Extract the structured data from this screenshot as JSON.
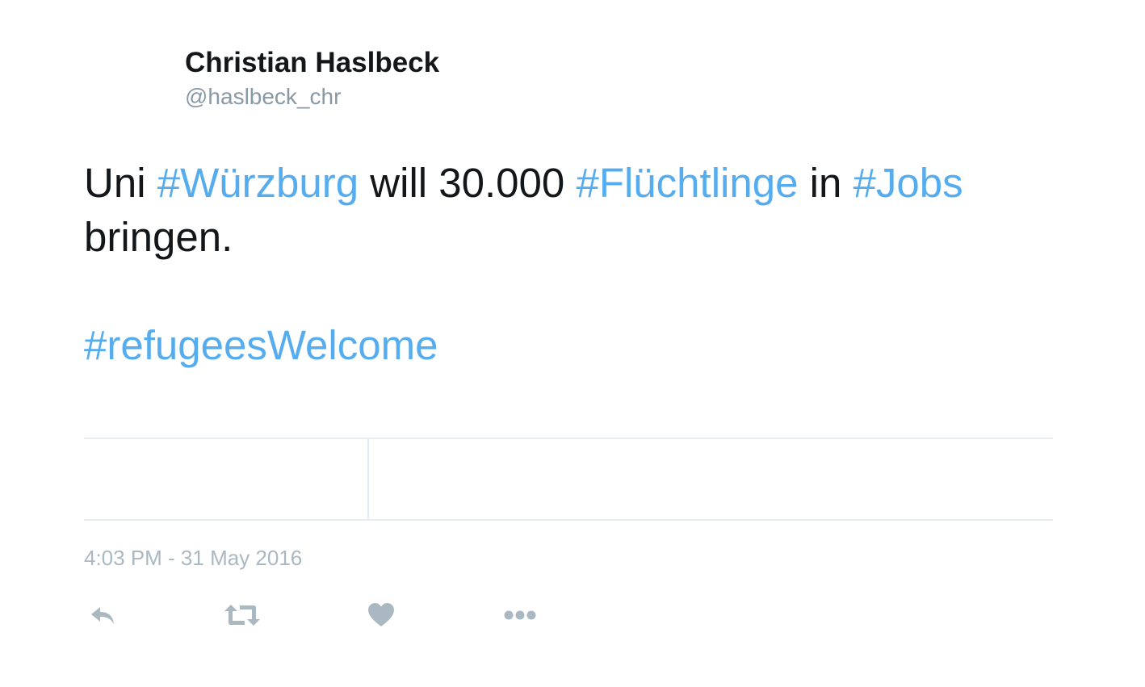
{
  "tweet": {
    "display_name": "Christian Haslbeck",
    "screen_name": "@haslbeck_chr",
    "text": {
      "line1": [
        {
          "text": "Uni ",
          "hashtag": false
        },
        {
          "text": "#Würzburg",
          "hashtag": true
        },
        {
          "text": " will 30.000 ",
          "hashtag": false
        },
        {
          "text": "#Flüchtlinge",
          "hashtag": true
        },
        {
          "text": " in ",
          "hashtag": false
        },
        {
          "text": "#Jobs",
          "hashtag": true
        }
      ],
      "line2": "bringen.",
      "line3": "#refugeesWelcome"
    },
    "timestamp": "4:03 PM - 31 May 2016"
  },
  "actions": {
    "reply_icon": "reply-icon",
    "retweet_icon": "retweet-icon",
    "like_icon": "heart-icon",
    "more_icon": "more-dots-icon"
  },
  "colors": {
    "hashtag": "#55acee",
    "text": "#14171a",
    "muted": "#8899a6",
    "icon": "#aab8c2",
    "divider": "#e6ecf0"
  }
}
